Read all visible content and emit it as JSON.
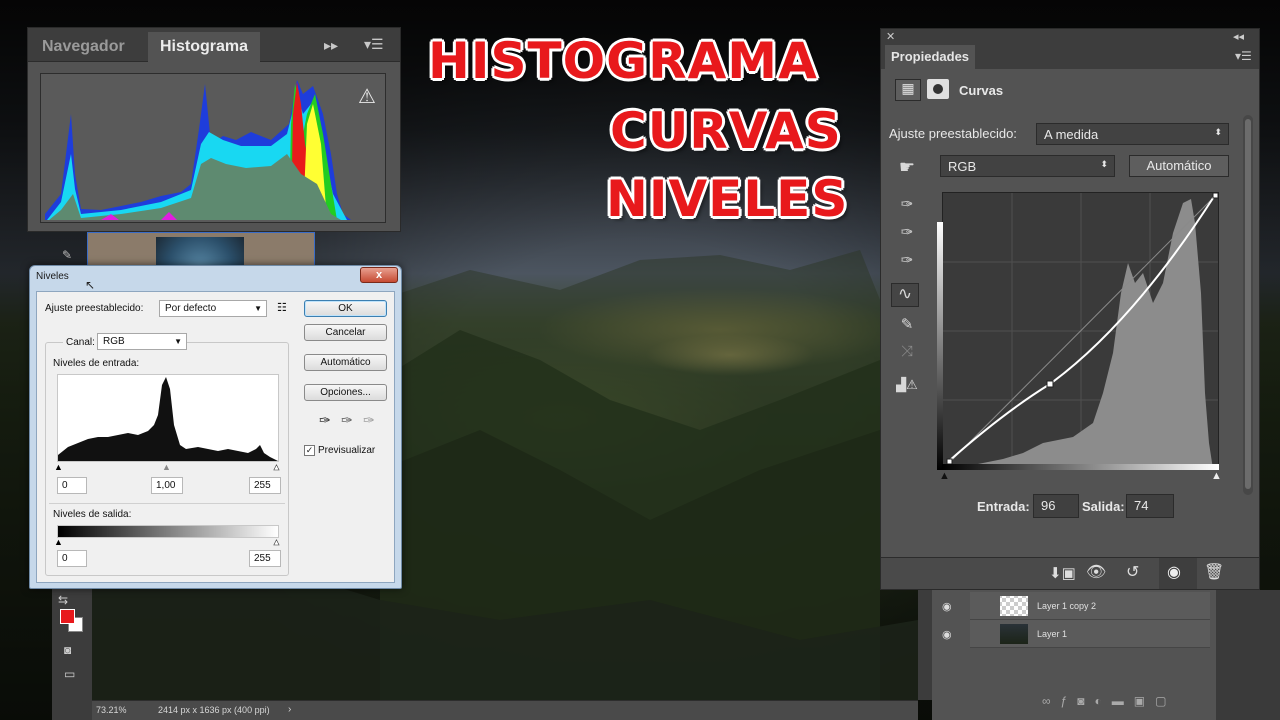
{
  "title_overlay": {
    "line1": "HISTOGRAMA",
    "line2": "CURVAS",
    "line3": "NIVELES"
  },
  "histogram_panel": {
    "tabs": [
      "Navegador",
      "Histograma"
    ],
    "active_tab": "Histograma",
    "warning_icon": "warning-triangle-icon"
  },
  "niveles_dialog": {
    "title": "Niveles",
    "close_label": "x",
    "preset_label": "Ajuste preestablecido:",
    "preset_value": "Por defecto",
    "canal_label": "Canal:",
    "canal_value": "RGB",
    "input_levels_label": "Niveles de entrada:",
    "input_values": [
      "0",
      "1,00",
      "255"
    ],
    "output_levels_label": "Niveles de salida:",
    "output_values": [
      "0",
      "255"
    ],
    "buttons": {
      "ok": "OK",
      "cancel": "Cancelar",
      "auto": "Automático",
      "options": "Opciones..."
    },
    "preview_label": "Previsualizar",
    "preview_checked": true
  },
  "properties_panel": {
    "tab": "Propiedades",
    "adjustment": "Curvas",
    "preset_label": "Ajuste preestablecido:",
    "preset_value": "A medida",
    "channel_value": "RGB",
    "auto_button": "Automático",
    "input_label": "Entrada:",
    "input_value": "96",
    "output_label": "Salida:",
    "output_value": "74"
  },
  "layers": [
    {
      "name": "Layer 1 copy 2"
    },
    {
      "name": "Layer 1"
    }
  ],
  "status_bar": {
    "zoom": "73.21%",
    "doc_info": "2414 px x 1636 px (400 ppi)"
  },
  "colors": {
    "title_red": "#e8191c",
    "foreground": "#e8191c",
    "background": "#ffffff"
  }
}
